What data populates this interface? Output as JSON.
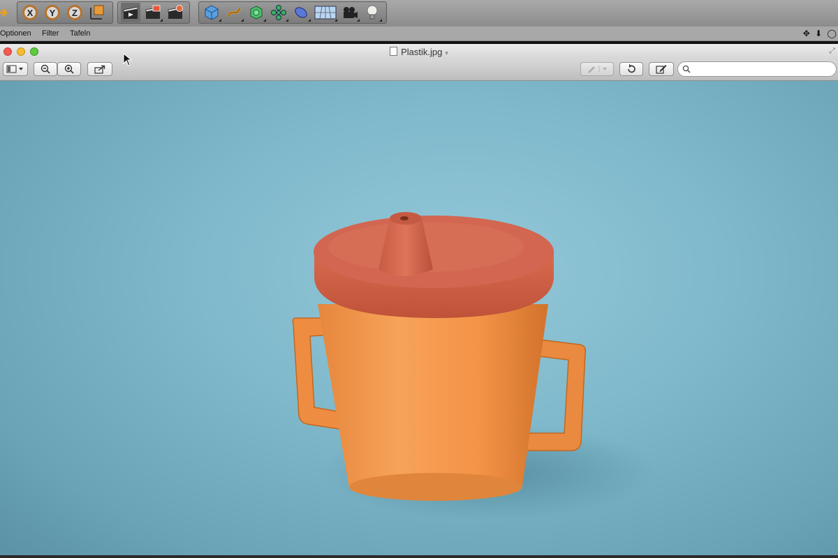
{
  "toolbar": {
    "axis_x": "X",
    "axis_y": "Y",
    "axis_z": "Z"
  },
  "menu": {
    "items": [
      "Optionen",
      "Filter",
      "Tafeln"
    ],
    "nav_glyphs": "✥ ⬇ ◯"
  },
  "preview": {
    "title": "Plastik.jpg",
    "title_caret": "▾",
    "search": {
      "value": "",
      "placeholder": ""
    }
  },
  "image": {
    "subject": "sippy-cup",
    "colors": {
      "background": "#86bfd0",
      "cup": "#f2954a",
      "lid": "#d4634a"
    }
  }
}
